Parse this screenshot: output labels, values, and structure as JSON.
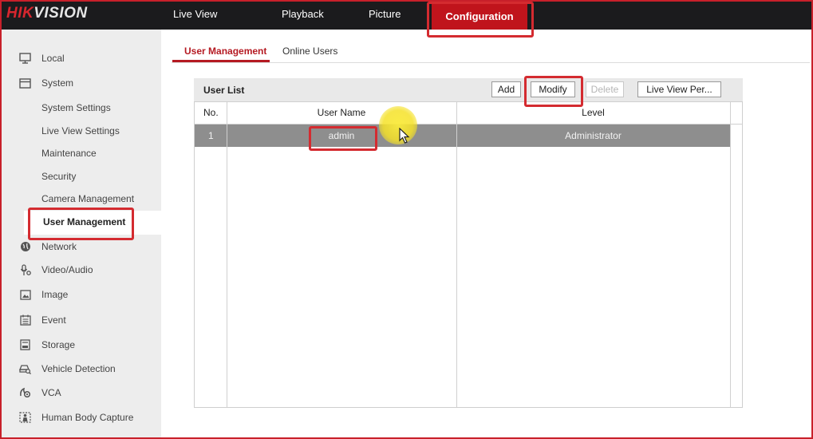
{
  "brand": {
    "part1": "HIK",
    "part2": "VISION"
  },
  "topnav": {
    "live_view": "Live View",
    "playback": "Playback",
    "picture": "Picture",
    "configuration": "Configuration"
  },
  "sidebar": {
    "local": "Local",
    "system": "System",
    "system_sub": [
      "System Settings",
      "Live View Settings",
      "Maintenance",
      "Security",
      "Camera Management",
      "User Management"
    ],
    "network": "Network",
    "video_audio": "Video/Audio",
    "image": "Image",
    "event": "Event",
    "storage": "Storage",
    "vehicle_detection": "Vehicle Detection",
    "vca": "VCA",
    "human_body_capture": "Human Body Capture"
  },
  "tabs": {
    "user_management": "User Management",
    "online_users": "Online Users"
  },
  "user_list": {
    "title": "User List",
    "buttons": {
      "add": "Add",
      "modify": "Modify",
      "delete": "Delete",
      "live_view_per": "Live View Per..."
    },
    "columns": {
      "no": "No.",
      "user_name": "User Name",
      "level": "Level"
    },
    "rows": [
      {
        "no": "1",
        "user_name": "admin",
        "level": "Administrator"
      }
    ]
  },
  "colors": {
    "accent": "#c0141c",
    "highlight": "#d42b30",
    "topbar": "#1b1b1d",
    "selected_row": "#8e8e8e"
  }
}
